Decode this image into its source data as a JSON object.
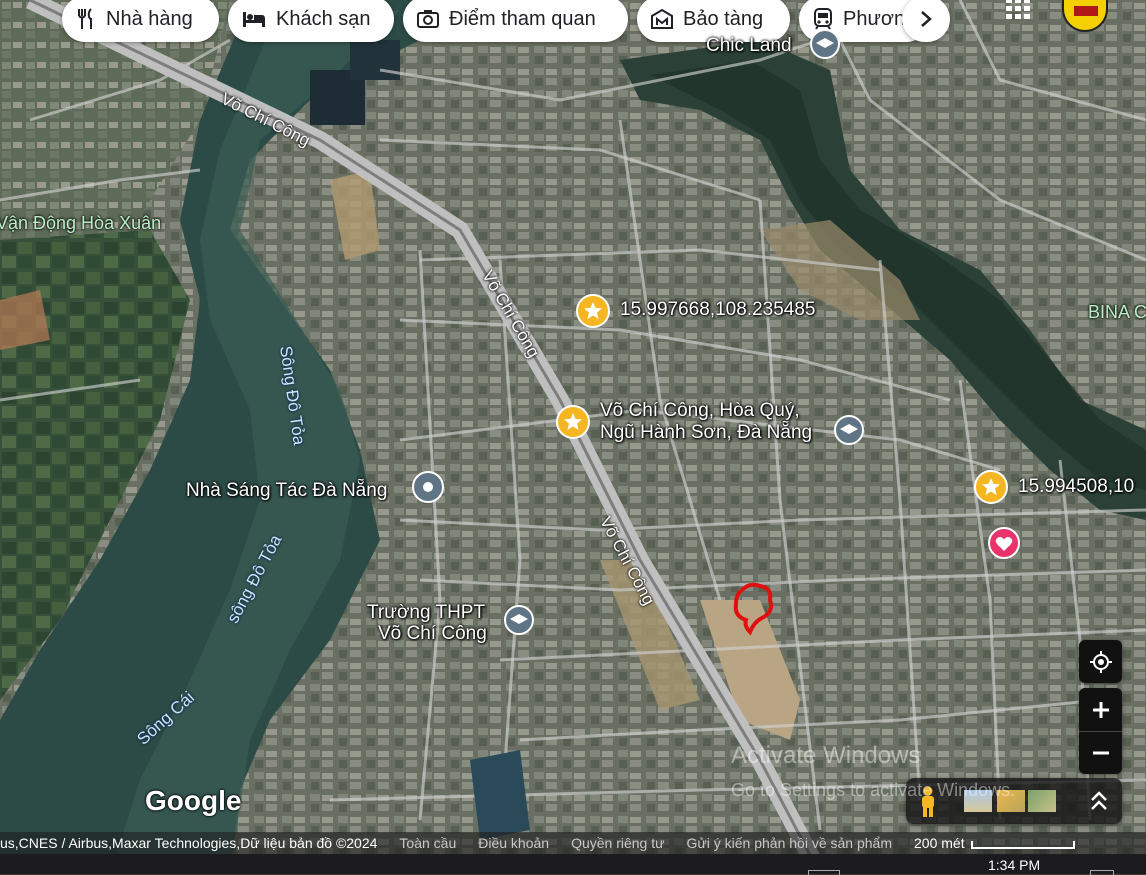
{
  "chips": [
    {
      "label": "Nhà hàng",
      "icon": "restaurant-icon"
    },
    {
      "label": "Khách sạn",
      "icon": "hotel-icon"
    },
    {
      "label": "Điểm tham quan",
      "icon": "camera-icon"
    },
    {
      "label": "Bảo tàng",
      "icon": "museum-icon"
    },
    {
      "label": "Phươn",
      "icon": "transit-icon"
    }
  ],
  "places": {
    "chic_land": "Chic Land",
    "van_dong": "Vận Động Hòa Xuân",
    "bina": "BINA C",
    "nha_sang_tac": "Nhà Sáng Tác Đà Nẵng",
    "truong_line1": "Trường THPT",
    "truong_line2": "Võ Chí Công",
    "address_line1": "Võ Chí Công, Hòa Quý,",
    "address_line2": "Ngũ Hành Sơn, Đà Nẵng",
    "coord_1": "15.997668,108.235485",
    "coord_2": "15.994508,10"
  },
  "roads": {
    "r1": "Võ Chí Công",
    "r2": "Võ Chí Công",
    "r3": "Võ Chí Công"
  },
  "rivers": {
    "do_toa_1": "Sông Đô Tỏa",
    "do_toa_2": "sông Đô Tỏa",
    "cai": "Sông Cái"
  },
  "logo": "Google",
  "attribution": {
    "credits": "us,CNES / Airbus,Maxar Technologies,Dữ liệu bản đồ ©2024",
    "global": "Toàn cầu",
    "terms": "Điều khoản",
    "privacy": "Quyền riêng tư",
    "feedback": "Gửi ý kiến phản hồi về sản phẩm",
    "scale": "200 mét"
  },
  "watermark": {
    "line1": "Activate Windows",
    "line2": "Go to Settings to activate Windows."
  },
  "taskbar": {
    "time": "1:34 PM"
  },
  "colors": {
    "star": "#f5b622",
    "pin_gray": "#5f7485",
    "heart_pin": "#e8336b",
    "drawn_shape": "#e01010"
  }
}
